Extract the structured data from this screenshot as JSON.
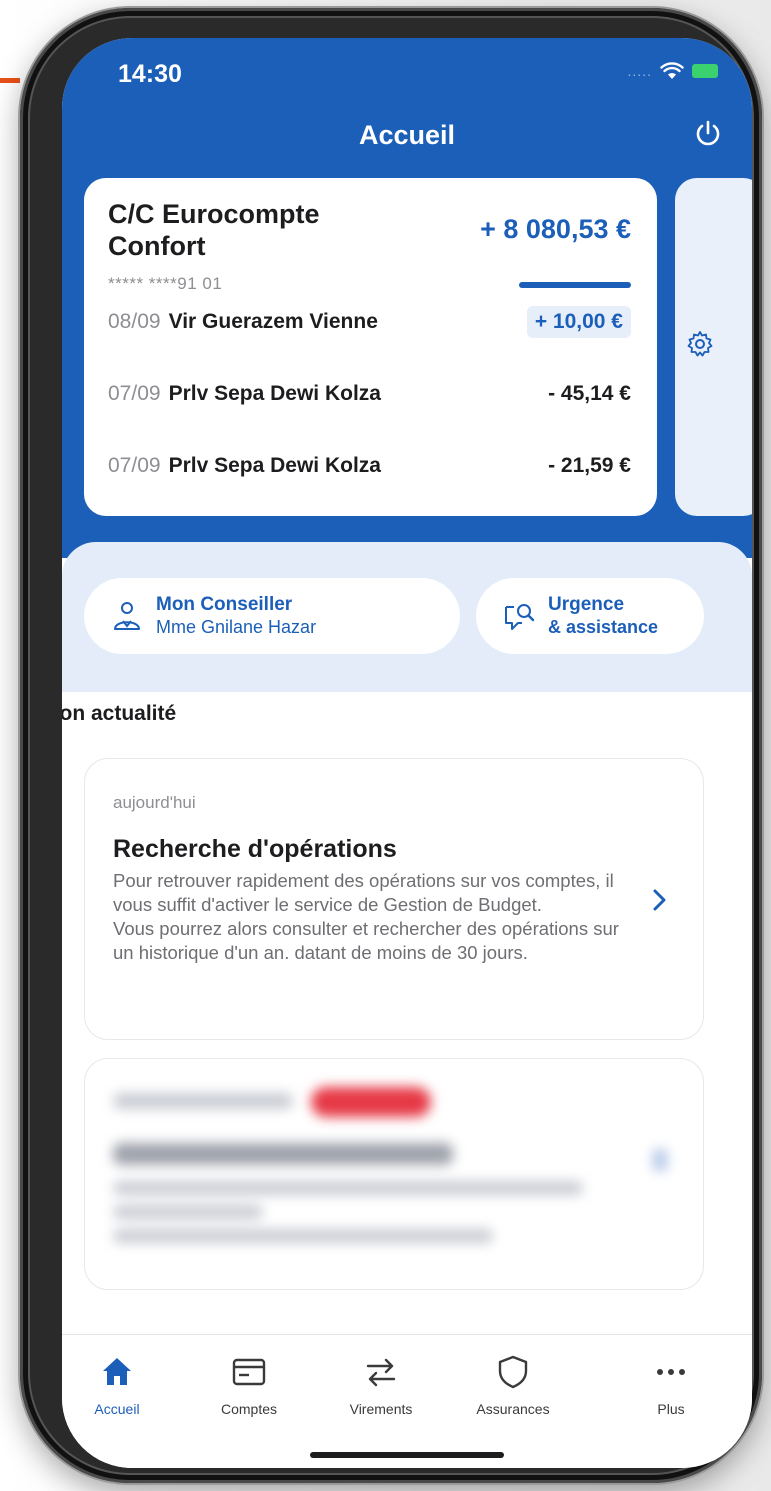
{
  "status_bar": {
    "time": "14:30",
    "signal": "....."
  },
  "header": {
    "title": "Accueil"
  },
  "account": {
    "name": "C/C Eurocompte Confort",
    "balance": "+ 8 080,53 €",
    "number": "***** ****91 01",
    "transactions": [
      {
        "date": "08/09",
        "label": "Vir Guerazem Vienne",
        "amount": "+ 10,00 €"
      },
      {
        "date": "07/09",
        "label": "Prlv Sepa Dewi Kolza",
        "amount": "- 45,14 €"
      },
      {
        "date": "07/09",
        "label": "Prlv Sepa Dewi Kolza",
        "amount": "- 21,59 €"
      }
    ]
  },
  "quick_actions": {
    "advisor": {
      "line1": "Mon Conseiller",
      "line2": "Mme Gnilane Hazar"
    },
    "urgence": {
      "line1": "Urgence",
      "line2": "& assistance"
    }
  },
  "news": {
    "section_title": "Mon actualité",
    "items": [
      {
        "date": "aujourd'hui",
        "title": "Recherche d'opérations",
        "body": "Pour retrouver rapidement des opérations sur vos comptes, il vous suffit d'activer le service de Gestion de Budget.\nVous pourrez alors consulter et rechercher des opérations sur un historique d'un an. datant de moins de 30 jours."
      }
    ]
  },
  "tabbar": {
    "items": [
      {
        "label": "Accueil"
      },
      {
        "label": "Comptes"
      },
      {
        "label": "Virements"
      },
      {
        "label": "Assurances"
      },
      {
        "label": "Plus"
      }
    ],
    "active_color": "#1c5fb9"
  },
  "colors": {
    "brand": "#1c5fb9",
    "positive_bg": "#e6eef9",
    "badge": "#e63946"
  }
}
